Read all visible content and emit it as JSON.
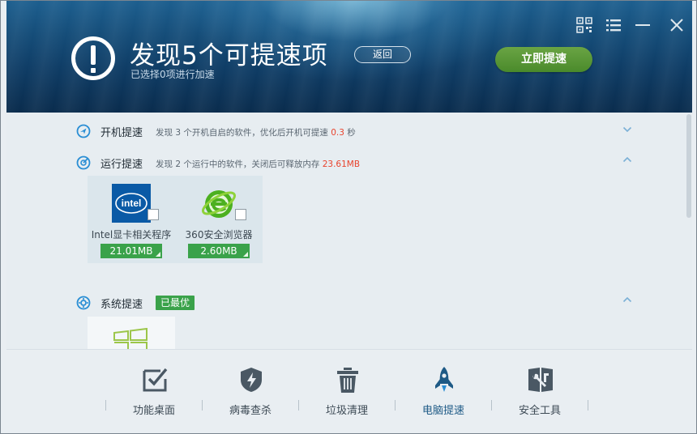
{
  "colors": {
    "header_top": "#1d5f8f",
    "header_bottom": "#0a2c4d",
    "accent_green": "#3aa24a",
    "button_green": "#5a9a37",
    "highlight_red": "#e8432d",
    "icon_blue": "#2a8ed4",
    "nav_icon": "#4a5864"
  },
  "header": {
    "icon": "exclamation-circle-icon",
    "title": "发现5个可提速项",
    "subtitle": "已选择0项进行加速",
    "back_label": "返回",
    "speedup_label": "立即提速",
    "window_controls": [
      "qr-code-icon",
      "menu-icon",
      "minimize-icon",
      "close-icon"
    ]
  },
  "sections": {
    "startup": {
      "icon": "boot-arrow-icon",
      "title": "开机提速",
      "desc_prefix": "发现 3 个开机自启的软件，优化后开机可提速 ",
      "desc_value": "0.3",
      "desc_suffix": " 秒",
      "chevron": "chevron-down-icon"
    },
    "runtime": {
      "icon": "gauge-icon",
      "title": "运行提速",
      "desc_prefix": "发现 2 个运行中的软件，关闭后可释放内存 ",
      "desc_value": "23.61MB",
      "chevron": "chevron-up-icon",
      "apps": [
        {
          "name": "Intel显卡相关程序",
          "size": "21.01MB",
          "icon": "intel-logo",
          "logo_text": "intel",
          "checked": false
        },
        {
          "name": "360安全浏览器",
          "size": "2.60MB",
          "icon": "360-browser-icon",
          "checked": false
        }
      ]
    },
    "system": {
      "icon": "gear-icon",
      "title": "系统提速",
      "badge": "已最优",
      "chevron": "chevron-up-icon"
    }
  },
  "nav": [
    {
      "label": "功能桌面",
      "icon": "checkbox-board-icon",
      "active": false
    },
    {
      "label": "病毒查杀",
      "icon": "shield-lightning-icon",
      "active": false
    },
    {
      "label": "垃圾清理",
      "icon": "trash-icon",
      "active": false
    },
    {
      "label": "电脑提速",
      "icon": "rocket-icon",
      "active": true
    },
    {
      "label": "安全工具",
      "icon": "tools-icon",
      "active": false
    }
  ]
}
